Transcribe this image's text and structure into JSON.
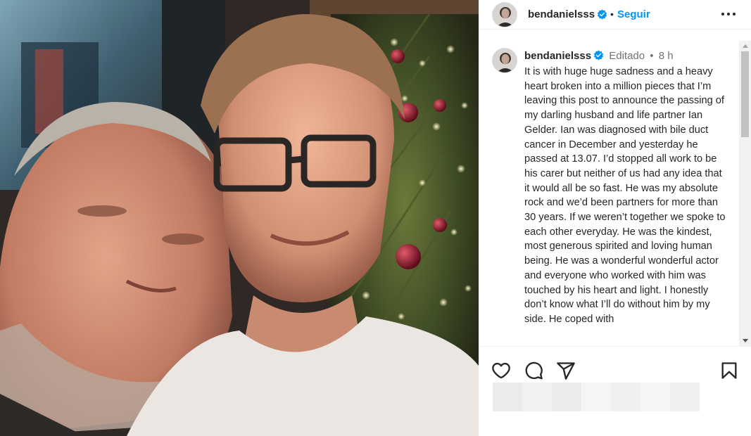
{
  "post": {
    "username": "bendanielsss",
    "verified": true,
    "follow_label": "Seguir",
    "separator": "•"
  },
  "caption": {
    "username": "bendanielsss",
    "edited_label": "Editado",
    "time_separator": "•",
    "time_ago": "8 h",
    "text": "It is with huge huge sadness and a heavy heart broken into a million pieces that I’m leaving this post to announce the passing of my darling husband and life partner Ian Gelder. Ian was diagnosed with bile duct cancer in December and yesterday he passed at 13.07. I’d stopped all work to be his carer but neither of us had any idea that it would all be so fast. He was my absolute rock and we’d been partners for more than 30 years. If we weren’t together we spoke to each other everyday. He was the kindest, most generous spirited and loving human being. He was a wonderful wonderful actor and everyone who worked with him was touched by his heart and light. I honestly don’t know what I’ll do without him by my side. He coped with"
  },
  "icons": {
    "more": "more-options-icon",
    "like": "heart-icon",
    "comment": "comment-icon",
    "share": "paper-plane-icon",
    "save": "bookmark-icon",
    "verified": "verified-badge-icon"
  },
  "colors": {
    "link_blue": "#0095f6",
    "verified_blue": "#0095f6",
    "text": "#262626",
    "muted": "#737373"
  }
}
